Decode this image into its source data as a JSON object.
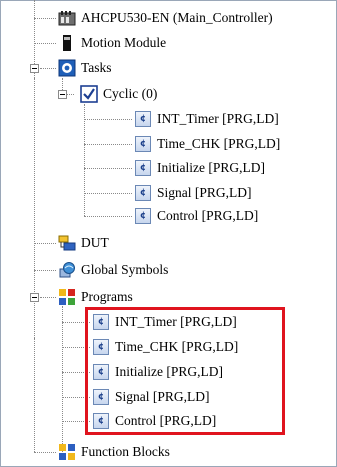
{
  "tree": {
    "controller": "AHCPU530-EN  (Main_Controller)",
    "motion_module": "Motion Module",
    "tasks": "Tasks",
    "cyclic": "Cyclic (0)",
    "task_programs": [
      "INT_Timer [PRG,LD]",
      "Time_CHK [PRG,LD]",
      "Initialize [PRG,LD]",
      "Signal [PRG,LD]",
      "Control [PRG,LD]"
    ],
    "dut": "DUT",
    "global_symbols": "Global Symbols",
    "programs": "Programs",
    "program_items": [
      "INT_Timer [PRG,LD]",
      "Time_CHK [PRG,LD]",
      "Initialize [PRG,LD]",
      "Signal [PRG,LD]",
      "Control [PRG,LD]"
    ],
    "function_blocks": "Function Blocks"
  },
  "icons": {
    "controller": "plc-controller-icon",
    "motion_module": "module-icon",
    "tasks": "tasks-gear-icon",
    "cyclic": "checkbox-icon",
    "program": "program-icon",
    "dut": "dut-icon",
    "global_symbols": "globe-icon",
    "programs": "programs-folder-icon",
    "function_blocks": "function-blocks-icon"
  },
  "colors": {
    "highlight_border": "#e0141e",
    "tree_line": "#8a8a8a"
  }
}
